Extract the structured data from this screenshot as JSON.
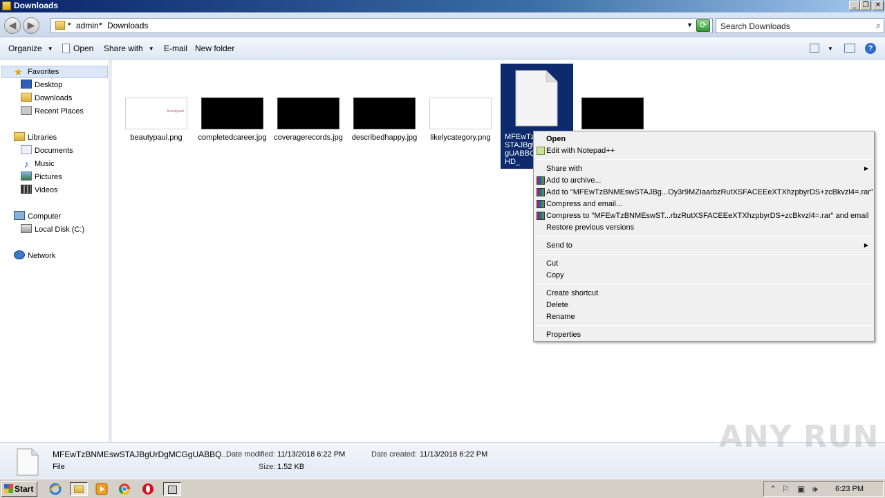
{
  "window": {
    "title": "Downloads",
    "min_glyph": "_",
    "max_glyph": "❐",
    "close_glyph": "✕"
  },
  "address": {
    "crumbs": [
      "admin",
      "Downloads"
    ],
    "search_placeholder": "Search Downloads"
  },
  "toolbar": {
    "organize": "Organize",
    "open": "Open",
    "share_with": "Share with",
    "email": "E-mail",
    "new_folder": "New folder"
  },
  "nav": {
    "favorites": "Favorites",
    "desktop": "Desktop",
    "downloads": "Downloads",
    "recent_places": "Recent Places",
    "libraries": "Libraries",
    "documents": "Documents",
    "music": "Music",
    "pictures": "Pictures",
    "videos": "Videos",
    "computer": "Computer",
    "local_disk": "Local Disk (C:)",
    "network": "Network"
  },
  "files": [
    {
      "name": "beautypaul.png",
      "thumb": "light",
      "thumb_text": "beautypaul"
    },
    {
      "name": "completedcareer.jpg",
      "thumb": "dark",
      "thumb_text": ""
    },
    {
      "name": "coveragerecords.jpg",
      "thumb": "dark",
      "thumb_text": ""
    },
    {
      "name": "describedhappy.jpg",
      "thumb": "dark",
      "thumb_text": ""
    },
    {
      "name": "likelycategory.png",
      "thumb": "light",
      "thumb_text": ""
    },
    {
      "name": "",
      "thumb": "dark",
      "thumb_text": ""
    }
  ],
  "selected_file": {
    "name_visible": "MFEwTzBNMEswSTAJBgUrDgMCGgUABBQwF4zbCEHD_"
  },
  "context_menu": {
    "open": "Open",
    "edit_notepad": "Edit with Notepad++",
    "share_with": "Share with",
    "add_archive": "Add to archive...",
    "add_to_rar": "Add to \"MFEwTzBNMEswSTAJBg...Oy3r9MZIaarbzRutXSFACEEeXTXhzpbyrDS+zcBkvzl4=.rar\"",
    "compress_email": "Compress and email...",
    "compress_to_rar_email": "Compress to \"MFEwTzBNMEswST...rbzRutXSFACEEeXTXhzpbyrDS+zcBkvzl4=.rar\" and email",
    "restore_versions": "Restore previous versions",
    "send_to": "Send to",
    "cut": "Cut",
    "copy": "Copy",
    "create_shortcut": "Create shortcut",
    "delete": "Delete",
    "rename": "Rename",
    "properties": "Properties"
  },
  "details": {
    "file_name": "MFEwTzBNMEswSTAJBgUrDgMCGgUABBQ...",
    "file_type": "File",
    "date_modified_label": "Date modified:",
    "date_modified": "11/13/2018 6:22 PM",
    "date_created_label": "Date created:",
    "date_created": "11/13/2018 6:22 PM",
    "size_label": "Size:",
    "size": "1.52 KB"
  },
  "taskbar": {
    "start": "Start",
    "clock": "6:23 PM"
  },
  "watermark": "ANY RUN",
  "colors": {
    "selection": "#0c2a6c",
    "title_start": "#0a246a",
    "menu_bg": "#f0f0f0"
  }
}
